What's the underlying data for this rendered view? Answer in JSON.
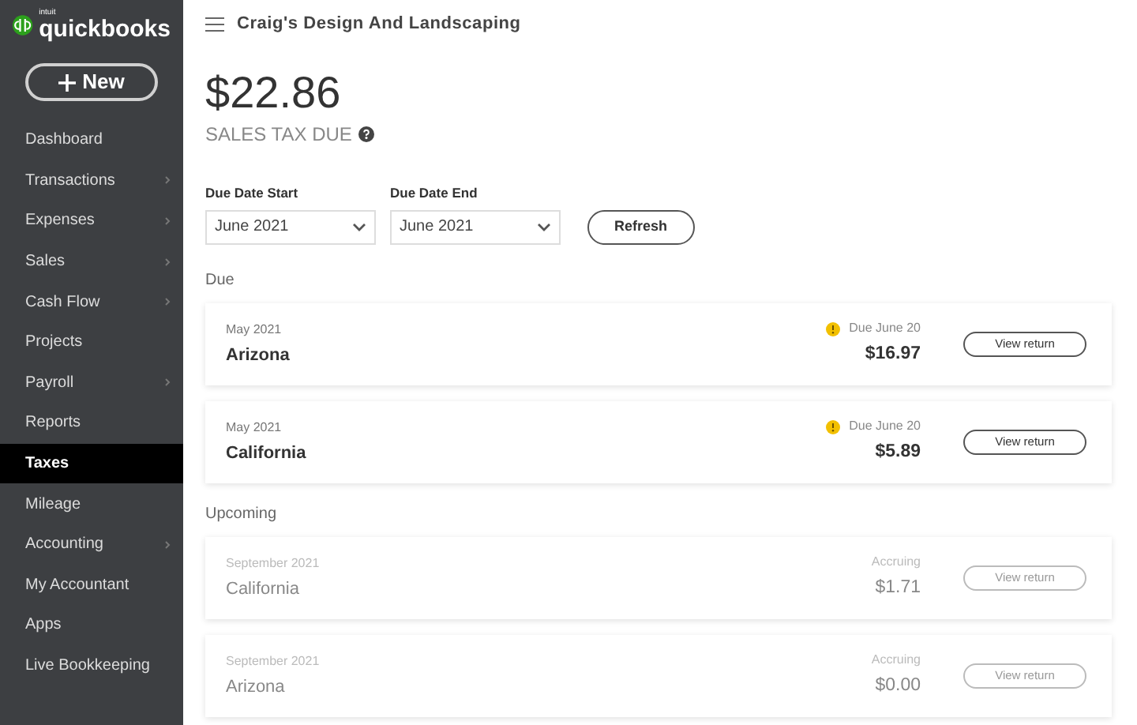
{
  "sidebar": {
    "logo_small": "intuit",
    "logo": "quickbooks",
    "new_button": "New",
    "items": [
      {
        "label": "Dashboard",
        "selected": false,
        "has_submenu": false
      },
      {
        "label": "Transactions",
        "selected": false,
        "has_submenu": true
      },
      {
        "label": "Expenses",
        "selected": false,
        "has_submenu": true
      },
      {
        "label": "Sales",
        "selected": false,
        "has_submenu": true
      },
      {
        "label": "Cash Flow",
        "selected": false,
        "has_submenu": true
      },
      {
        "label": "Projects",
        "selected": false,
        "has_submenu": false
      },
      {
        "label": "Payroll",
        "selected": false,
        "has_submenu": true
      },
      {
        "label": "Reports",
        "selected": false,
        "has_submenu": false
      },
      {
        "label": "Taxes",
        "selected": true,
        "has_submenu": false
      },
      {
        "label": "Mileage",
        "selected": false,
        "has_submenu": false
      },
      {
        "label": "Accounting",
        "selected": false,
        "has_submenu": true
      },
      {
        "label": "My Accountant",
        "selected": false,
        "has_submenu": false
      },
      {
        "label": "Apps",
        "selected": false,
        "has_submenu": false
      },
      {
        "label": "Live Bookkeeping",
        "selected": false,
        "has_submenu": false
      }
    ]
  },
  "header": {
    "company": "Craig's Design And Landscaping"
  },
  "summary": {
    "amount": "$22.86",
    "label": "SALES TAX DUE"
  },
  "filters": [
    {
      "label": "Due Date Start",
      "value": "June 2021"
    },
    {
      "label": "Due Date End",
      "value": "June 2021"
    }
  ],
  "refresh_button": "Refresh",
  "sections": [
    {
      "title": "Due",
      "kind": "due",
      "returns": [
        {
          "period": "May 2021",
          "state": "Arizona",
          "status": "Due June 20",
          "amount": "$16.97",
          "button": "View return"
        },
        {
          "period": "May 2021",
          "state": "California",
          "status": "Due June 20",
          "amount": "$5.89",
          "button": "View return"
        }
      ]
    },
    {
      "title": "Upcoming",
      "kind": "upcoming",
      "returns": [
        {
          "period": "September 2021",
          "state": "California",
          "status": "Accruing",
          "amount": "$1.71",
          "button": "View return"
        },
        {
          "period": "September 2021",
          "state": "Arizona",
          "status": "Accruing",
          "amount": "$0.00",
          "button": "View return"
        }
      ]
    }
  ]
}
